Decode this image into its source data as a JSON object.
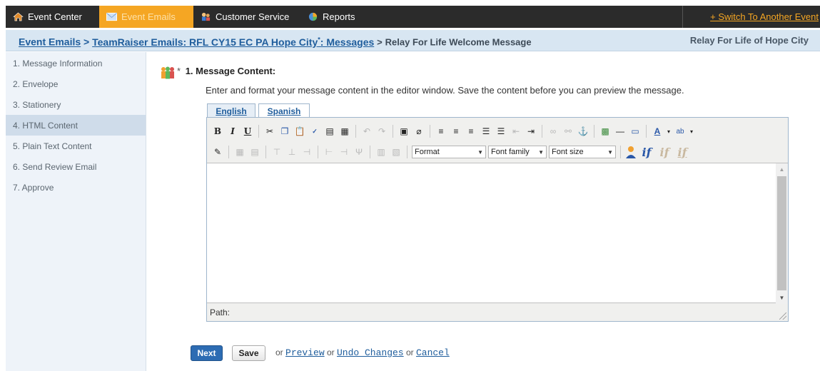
{
  "topnav": {
    "tabs": [
      {
        "label": "Event Center",
        "icon": "home-icon"
      },
      {
        "label": "Event Emails",
        "icon": "envelope-icon",
        "active": true
      },
      {
        "label": "Customer Service",
        "icon": "people-icon"
      },
      {
        "label": "Reports",
        "icon": "pie-chart-icon"
      }
    ],
    "switch_event": "+ Switch To Another Event",
    "active_color": "#f5a623"
  },
  "breadcrumb": {
    "link1": "Event Emails",
    "link2": "TeamRaiser Emails: RFL CY15 EC PA Hope City",
    "link2_suffix": "*",
    "link2_tail": ": Messages",
    "separator": ">",
    "current": "Relay For Life Welcome Message",
    "org": "Relay For Life of Hope City"
  },
  "sidebar": {
    "items": [
      {
        "label": "1.  Message Information"
      },
      {
        "label": "2.  Envelope"
      },
      {
        "label": "3.  Stationery"
      },
      {
        "label": "4.  HTML Content",
        "active": true
      },
      {
        "label": "5.  Plain Text Content"
      },
      {
        "label": "6.  Send Review Email"
      },
      {
        "label": "7.  Approve"
      }
    ]
  },
  "main": {
    "required_star": "*",
    "section_title": "1.  Message Content:",
    "instructions": "Enter and format your message content in the editor window. Save the content before you can preview the message.",
    "lang_tabs": [
      {
        "label": "English"
      },
      {
        "label": "Spanish",
        "active": true
      }
    ],
    "editor": {
      "format_select": "Format",
      "font_family_select": "Font family",
      "font_size_select": "Font size",
      "path_label": "Path:",
      "if_label": "if"
    },
    "buttons": {
      "next": "Next",
      "save": "Save"
    },
    "links": {
      "or1": "or",
      "preview": "Preview",
      "or2": "or",
      "undo": "Undo Changes",
      "or3": "or",
      "cancel": "Cancel"
    }
  }
}
